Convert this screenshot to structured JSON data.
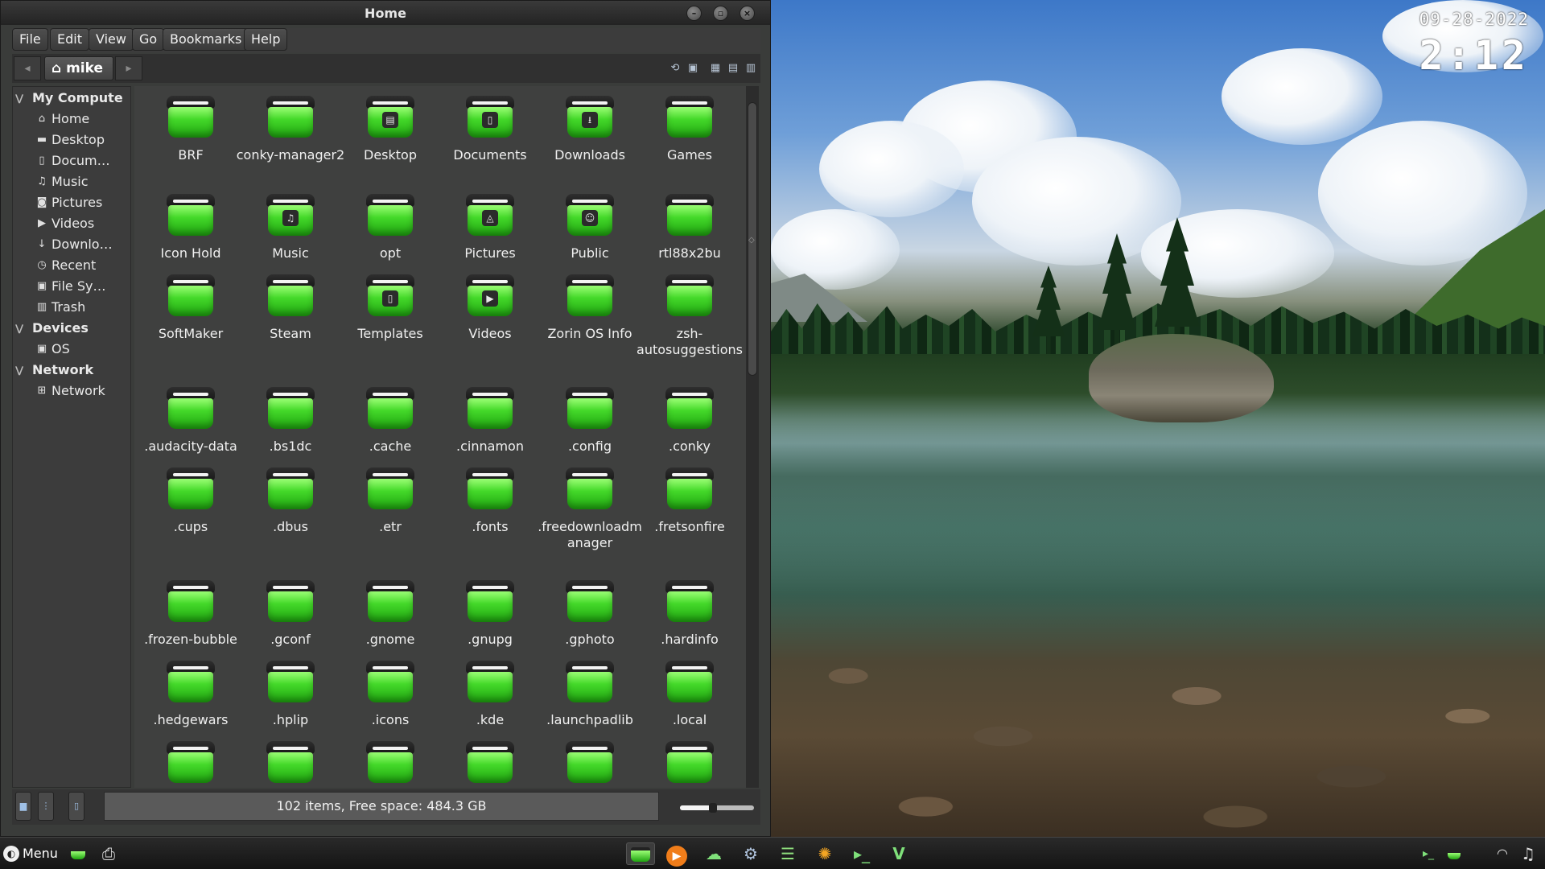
{
  "window": {
    "title": "Home"
  },
  "menubar": [
    "File",
    "Edit",
    "View",
    "Go",
    "Bookmarks",
    "Help"
  ],
  "toolbar": {
    "location": "mike"
  },
  "sidebar": {
    "sections": [
      {
        "title": "My Compute",
        "items": [
          {
            "label": "Home",
            "icon": "home-icon"
          },
          {
            "label": "Desktop",
            "icon": "folder-icon"
          },
          {
            "label": "Docum…",
            "icon": "document-icon"
          },
          {
            "label": "Music",
            "icon": "music-icon"
          },
          {
            "label": "Pictures",
            "icon": "camera-icon"
          },
          {
            "label": "Videos",
            "icon": "video-icon"
          },
          {
            "label": "Downlo…",
            "icon": "download-icon"
          },
          {
            "label": "Recent",
            "icon": "clock-icon"
          },
          {
            "label": "File Sy…",
            "icon": "drive-icon"
          },
          {
            "label": "Trash",
            "icon": "trash-icon"
          }
        ]
      },
      {
        "title": "Devices",
        "items": [
          {
            "label": "OS",
            "icon": "drive-icon"
          }
        ]
      },
      {
        "title": "Network",
        "items": [
          {
            "label": "Network",
            "icon": "network-icon"
          }
        ]
      }
    ]
  },
  "files": {
    "rows": [
      [
        {
          "name": "BRF"
        },
        {
          "name": "conky-manager2"
        },
        {
          "name": "Desktop",
          "emblem": "desktop"
        },
        {
          "name": "Documents",
          "emblem": "document"
        },
        {
          "name": "Downloads",
          "emblem": "download"
        },
        {
          "name": "Games"
        }
      ],
      [
        {
          "name": "Icon Hold"
        },
        {
          "name": "Music",
          "emblem": "music"
        },
        {
          "name": "opt"
        },
        {
          "name": "Pictures",
          "emblem": "picture"
        },
        {
          "name": "Public",
          "emblem": "people"
        },
        {
          "name": "rtl88x2bu"
        }
      ],
      [
        {
          "name": "SoftMaker"
        },
        {
          "name": "Steam"
        },
        {
          "name": "Templates",
          "emblem": "document"
        },
        {
          "name": "Videos",
          "emblem": "play"
        },
        {
          "name": "Zorin OS Info"
        },
        {
          "name": "zsh-autosuggestions"
        }
      ],
      [
        {
          "name": ".audacity-data"
        },
        {
          "name": ".bs1dc"
        },
        {
          "name": ".cache"
        },
        {
          "name": ".cinnamon"
        },
        {
          "name": ".config"
        },
        {
          "name": ".conky"
        }
      ],
      [
        {
          "name": ".cups"
        },
        {
          "name": ".dbus"
        },
        {
          "name": ".etr"
        },
        {
          "name": ".fonts"
        },
        {
          "name": ".freedownloadmanager"
        },
        {
          "name": ".fretsonfire"
        }
      ],
      [
        {
          "name": ".frozen-bubble"
        },
        {
          "name": ".gconf"
        },
        {
          "name": ".gnome"
        },
        {
          "name": ".gnupg"
        },
        {
          "name": ".gphoto"
        },
        {
          "name": ".hardinfo"
        }
      ],
      [
        {
          "name": ".hedgewars"
        },
        {
          "name": ".hplip"
        },
        {
          "name": ".icons"
        },
        {
          "name": ".kde"
        },
        {
          "name": ".launchpadlib"
        },
        {
          "name": ".local"
        }
      ],
      [
        {
          "name": ""
        },
        {
          "name": ""
        },
        {
          "name": ""
        },
        {
          "name": ""
        },
        {
          "name": ""
        },
        {
          "name": ""
        }
      ]
    ]
  },
  "statusbar": {
    "text": "102 items, Free space: 484.3 GB",
    "zoom_fraction": 0.45
  },
  "desktop": {
    "date": "09-28-2022",
    "time": "2:12"
  },
  "taskbar": {
    "menu_label": "Menu",
    "launchers": [
      "files-icon",
      "printer-icon"
    ],
    "apps": [
      "file-manager-icon",
      "media-player-icon",
      "cloud-upload-icon",
      "settings-icon",
      "text-editor-icon",
      "sun-icon",
      "terminal-icon",
      "vivaldi-icon"
    ],
    "tray": [
      "terminal-tray-icon",
      "files-tray-icon",
      "wifi-icon",
      "music-tray-icon"
    ]
  },
  "colors": {
    "folder_green": "#44d92a",
    "window_bg": "#3f403f",
    "titlebar": "#2b2b2b"
  }
}
